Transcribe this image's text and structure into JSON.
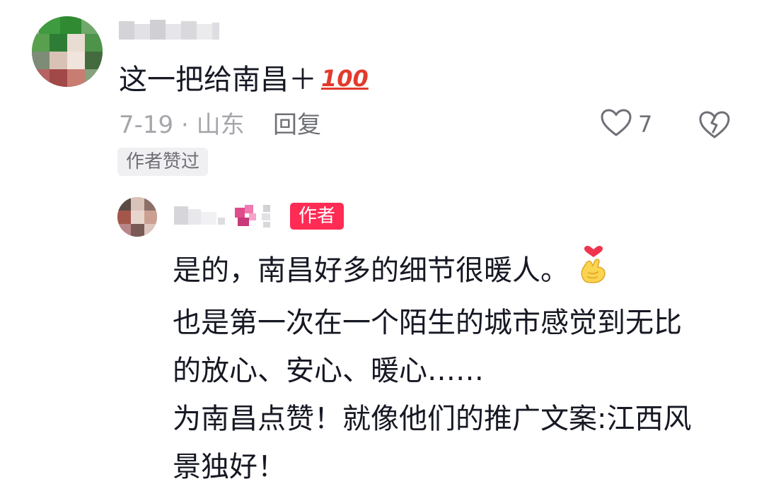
{
  "comment": {
    "username": "",
    "text": "这一把给南昌＋",
    "emoji_label": "100",
    "date_location": "7-19 · 山东",
    "reply_label": "回复",
    "like_count": "7",
    "author_liked_tag": "作者赞过",
    "icons": {
      "like": "heart-outline-icon",
      "dislike": "broken-heart-icon"
    }
  },
  "reply": {
    "username": "",
    "author_badge": "作者",
    "lines": [
      "是的，南昌好多的细节很暖人。",
      "也是第一次在一个陌生的城市感觉到无比",
      "的放心、安心、暖心……",
      "为南昌点赞！就像他们的推广文案:江西风",
      "景独好！"
    ],
    "emoji": "finger-heart-icon"
  },
  "colors": {
    "text": "#161823",
    "secondary": "#a5a6ab",
    "reply_link": "#6f7077",
    "badge": "#fe2c55",
    "tag_bg": "#f0f0f2"
  }
}
